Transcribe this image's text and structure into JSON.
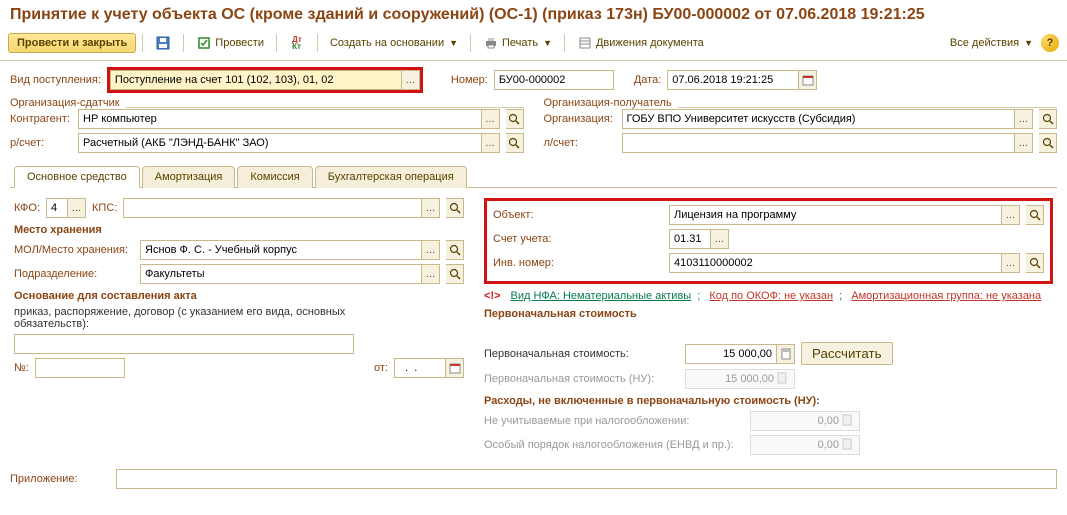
{
  "title": "Принятие к учету объекта ОС (кроме зданий и сооружений) (ОС-1) (приказ 173н) БУ00-000002 от 07.06.2018 19:21:25",
  "toolbar": {
    "main_btn": "Провести и закрыть",
    "post": "Провести",
    "create_based": "Создать на основании",
    "print": "Печать",
    "movements": "Движения документа",
    "all_actions": "Все действия"
  },
  "top": {
    "receipt_type_lbl": "Вид поступления:",
    "receipt_type_val": "Поступление на счет 101 (102, 103), 01, 02",
    "number_lbl": "Номер:",
    "number_val": "БУ00-000002",
    "date_lbl": "Дата:",
    "date_val": "07.06.2018 19:21:25"
  },
  "sender": {
    "legend": "Организация-сдатчик",
    "counterparty_lbl": "Контрагент:",
    "counterparty_val": "НР компьютер",
    "account_lbl": "р/счет:",
    "account_val": "Расчетный (АКБ \"ЛЭНД-БАНК\" ЗАО)"
  },
  "receiver": {
    "legend": "Организация-получатель",
    "org_lbl": "Организация:",
    "org_val": "ГОБУ ВПО Университет искусств (Субсидия)",
    "laccount_lbl": "л/счет:"
  },
  "tabs": {
    "t1": "Основное средство",
    "t2": "Амортизация",
    "t3": "Комиссия",
    "t4": "Бухгалтерская операция"
  },
  "main": {
    "kfo_lbl": "КФО:",
    "kfo_val": "4",
    "kps_lbl": "КПС:",
    "storage_title": "Место хранения",
    "mol_lbl": "МОЛ/Место хранения:",
    "mol_val": "Яснов Ф. С. - Учебный корпус",
    "dep_lbl": "Подразделение:",
    "dep_val": "Факультеты",
    "basis_title": "Основание для составления акта",
    "basis_text": "приказ, распоряжение, договор (с указанием его вида, основных обязательств):",
    "num_lbl": "№:",
    "ot_lbl": "от:",
    "object_lbl": "Объект:",
    "object_val": "Лицензия на программу",
    "acct_lbl": "Счет учета:",
    "acct_val": "01.31",
    "inv_lbl": "Инв. номер:",
    "inv_val": "4103110000002",
    "nfa_prefix": "Вид НФА: Нематериальные активы",
    "nfa_okof": "Код по ОКОФ: не указан",
    "nfa_amort": "Амортизационная группа: не указана",
    "cost_title": "Первоначальная стоимость",
    "cost_lbl": "Первоначальная стоимость:",
    "cost_val": "15 000,00",
    "calc_btn": "Рассчитать",
    "cost_nu_lbl": "Первоначальная стоимость (НУ):",
    "cost_nu_val": "15 000,00",
    "exp_title": "Расходы, не включенные в первоначальную стоимость (НУ):",
    "exp1_lbl": "Не учитываемые при налогообложении:",
    "exp1_val": "0,00",
    "exp2_lbl": "Особый порядок налогообложения (ЕНВД и пр.):",
    "exp2_val": "0,00",
    "attach_lbl": "Приложение:"
  }
}
